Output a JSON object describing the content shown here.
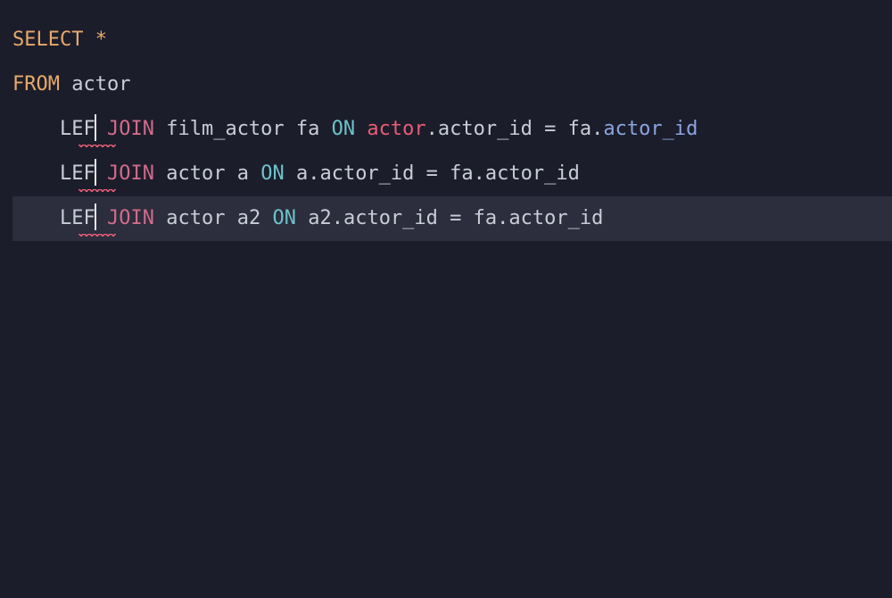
{
  "code": {
    "line1": {
      "select": "SELECT",
      "star": "*"
    },
    "line2": {
      "from": "FROM",
      "table": "actor"
    },
    "line3": {
      "lef": "LEF",
      "join": "JOIN",
      "table": "film_actor",
      "alias": "fa",
      "on": "ON",
      "left_tbl": "actor",
      "dot1": ".",
      "left_col": "actor_id",
      "eq": "=",
      "right_tbl": "fa",
      "dot2": ".",
      "right_col": "actor_id"
    },
    "line4": {
      "lef": "LEF",
      "join": "JOIN",
      "table": "actor",
      "alias": "a",
      "on": "ON",
      "left_tbl": "a",
      "dot1": ".",
      "left_col": "actor_id",
      "eq": "=",
      "right_tbl": "fa",
      "dot2": ".",
      "right_col": "actor_id"
    },
    "line5": {
      "lef": "LEF",
      "join": "JOIN",
      "table": "actor",
      "alias": "a2",
      "on": "ON",
      "left_tbl": "a2",
      "dot1": ".",
      "left_col": "actor_id",
      "eq": "=",
      "right_tbl": "fa",
      "dot2": ".",
      "right_col": "actor_id"
    }
  }
}
